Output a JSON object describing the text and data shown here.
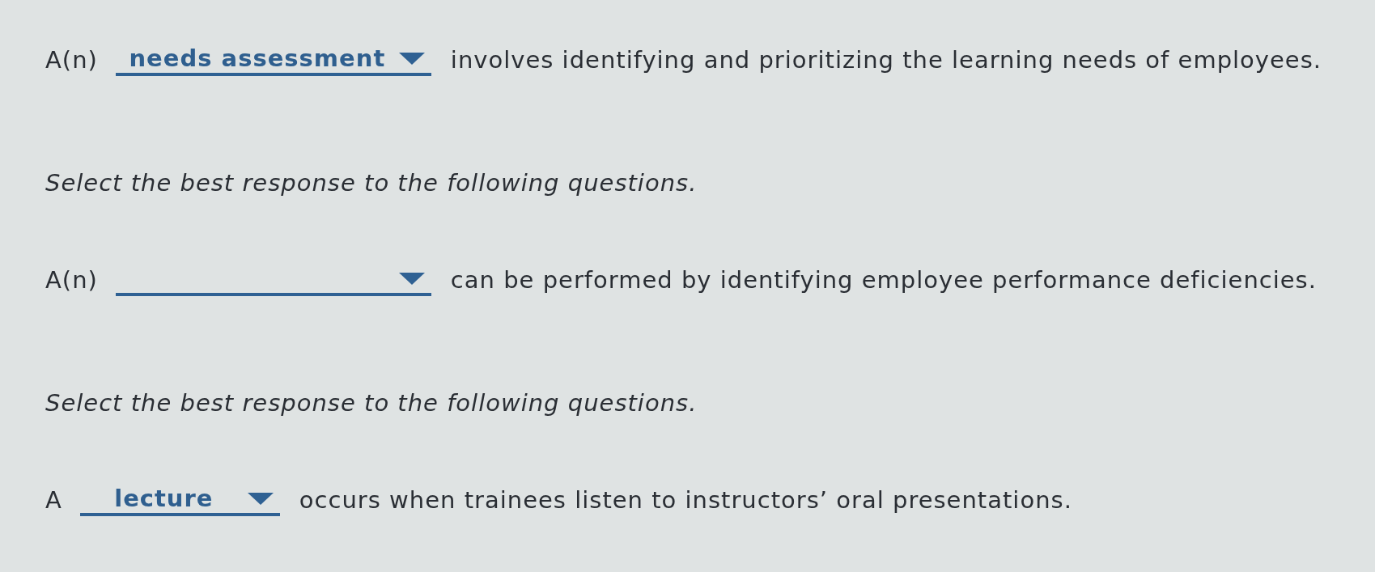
{
  "items": [
    {
      "kind": "question",
      "before": "A(n)",
      "answer": "needs assessment",
      "after": "involves identifying and prioritizing the learning needs of employees."
    },
    {
      "kind": "instruction",
      "text": "Select the best response to the following questions."
    },
    {
      "kind": "question",
      "before": "A(n)",
      "after": "can be performed by identifying employee performance deficiencies."
    },
    {
      "kind": "instruction",
      "text": "Select the best response to the following questions."
    },
    {
      "kind": "question",
      "before": "A",
      "answer": "lecture",
      "after": "occurs when trainees listen to instructors’ oral presentations."
    }
  ]
}
